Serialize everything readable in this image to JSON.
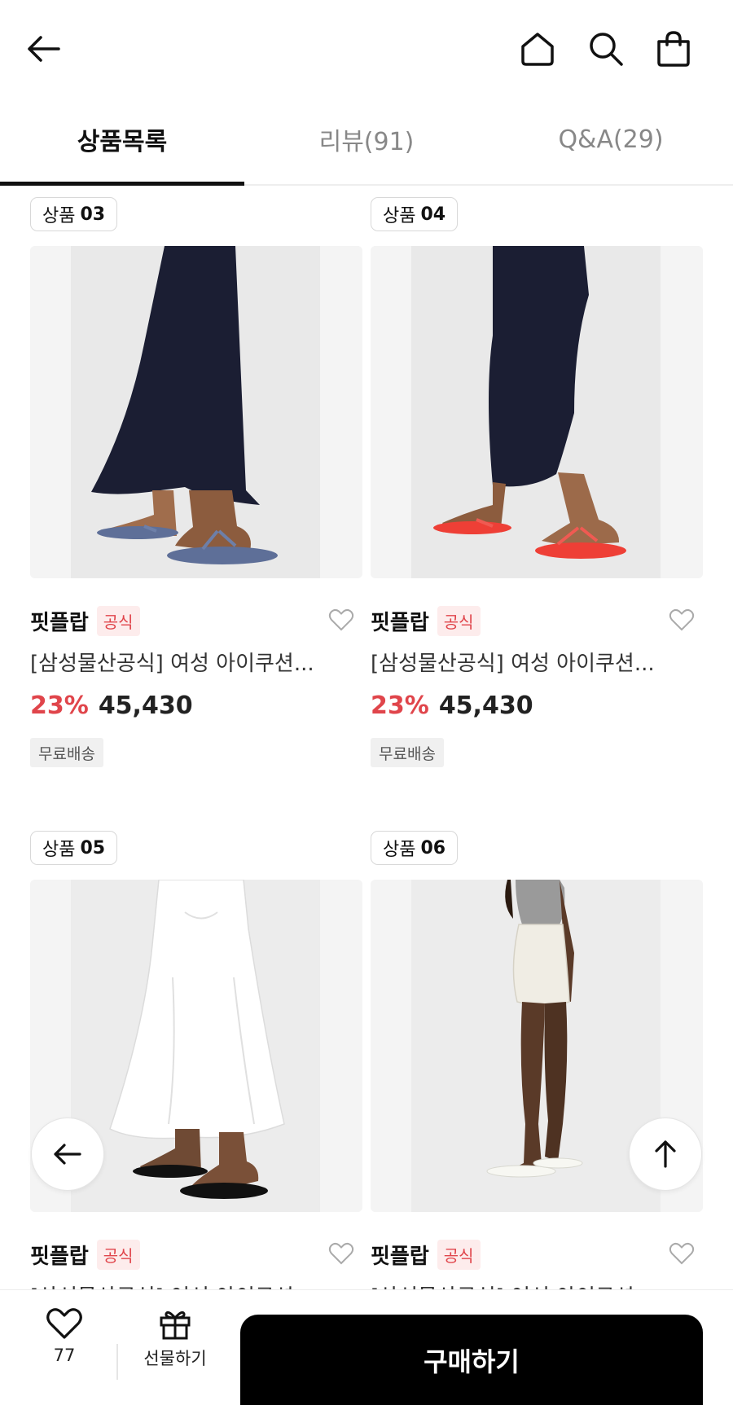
{
  "header": {
    "back_icon": "arrow-left-icon",
    "home_icon": "home-icon",
    "search_icon": "search-icon",
    "bag_icon": "shopping-bag-icon"
  },
  "tabs": [
    {
      "label": "상품목록",
      "active": true
    },
    {
      "label": "리뷰(91)",
      "active": false
    },
    {
      "label": "Q&A(29)",
      "active": false
    }
  ],
  "products": [
    {
      "badge_prefix": "상품",
      "badge_num": "03",
      "brand": "핏플랍",
      "official": "공식",
      "title": "[삼성물산공식] 여성 아이쿠션...",
      "discount": "23%",
      "price": "45,430",
      "shipping": "무료배송"
    },
    {
      "badge_prefix": "상품",
      "badge_num": "04",
      "brand": "핏플랍",
      "official": "공식",
      "title": "[삼성물산공식] 여성 아이쿠션...",
      "discount": "23%",
      "price": "45,430",
      "shipping": "무료배송"
    },
    {
      "badge_prefix": "상품",
      "badge_num": "05",
      "brand": "핏플랍",
      "official": "공식",
      "title": "[삼성물산공식] 여성 아이쿠션...",
      "discount": "",
      "price": "",
      "shipping": ""
    },
    {
      "badge_prefix": "상품",
      "badge_num": "06",
      "brand": "핏플랍",
      "official": "공식",
      "title": "[삼성물산공식] 여성 아이쿠션...",
      "discount": "",
      "price": "",
      "shipping": ""
    }
  ],
  "bottom_bar": {
    "like_count": "77",
    "gift_label": "선물하기",
    "buy_label": "구매하기"
  },
  "colors": {
    "accent_red": "#e0454b",
    "dark_skirt": "#1b1e33",
    "sandal_blue": "#5e6f98",
    "sandal_red": "#ee3f36",
    "white_dress": "#ffffff"
  }
}
